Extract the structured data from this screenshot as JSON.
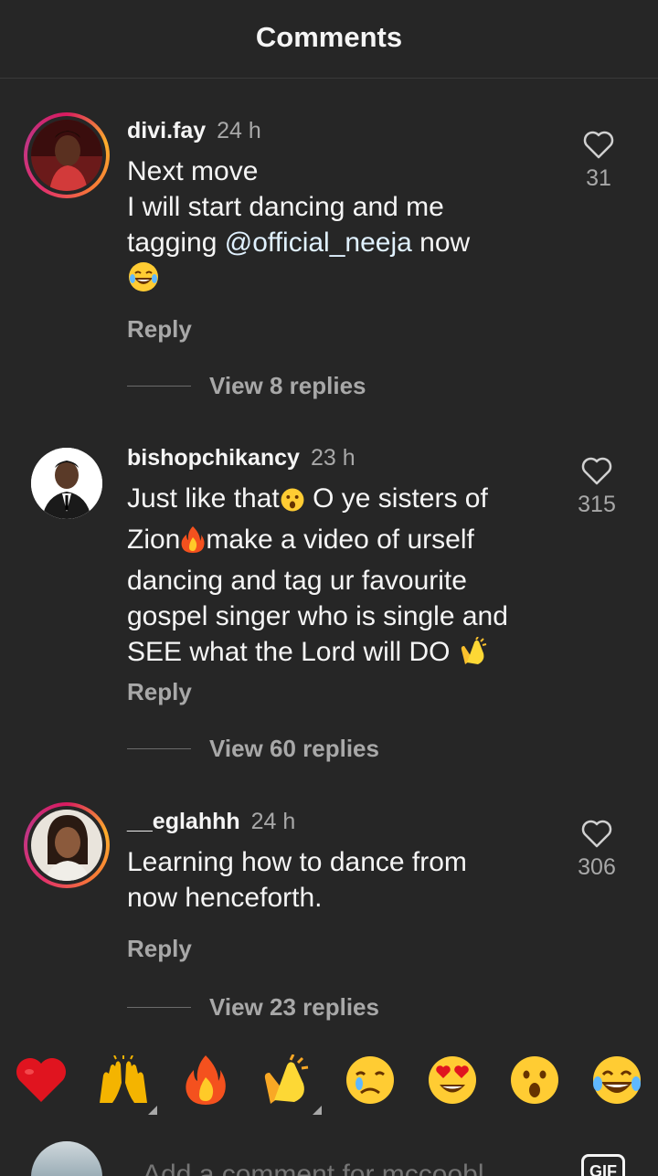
{
  "header": {
    "title": "Comments"
  },
  "comments": [
    {
      "username": "divi.fay",
      "time": "24 h",
      "text_lines": [
        "Next move",
        "I will start dancing and me",
        "tagging "
      ],
      "mention": "@official_neeja",
      "text_after_mention": " now",
      "likes": "31",
      "reply_label": "Reply",
      "view_replies": "View 8 replies"
    },
    {
      "username": "bishopchikancy",
      "time": "23 h",
      "text_parts": [
        "Just like that",
        " O ye sisters of",
        "Zion",
        "make a video of urself",
        "dancing and tag ur favourite",
        "gospel singer who is single and",
        "SEE what the Lord will DO "
      ],
      "likes": "315",
      "reply_label": "Reply",
      "view_replies": "View 60 replies"
    },
    {
      "username": "__eglahhh",
      "time": "24 h",
      "text": "Learning how to dance from\nnow henceforth.",
      "likes": "306",
      "reply_label": "Reply",
      "view_replies": "View 23 replies"
    }
  ],
  "reactions": [
    "red-heart",
    "raising-hands",
    "fire",
    "clapping-hands",
    "crying-face",
    "heart-eyes-face",
    "surprised-face",
    "laughing-tears-face"
  ],
  "composer": {
    "placeholder": "Add a comment for mccoobl...",
    "gif_label": "GIF"
  }
}
